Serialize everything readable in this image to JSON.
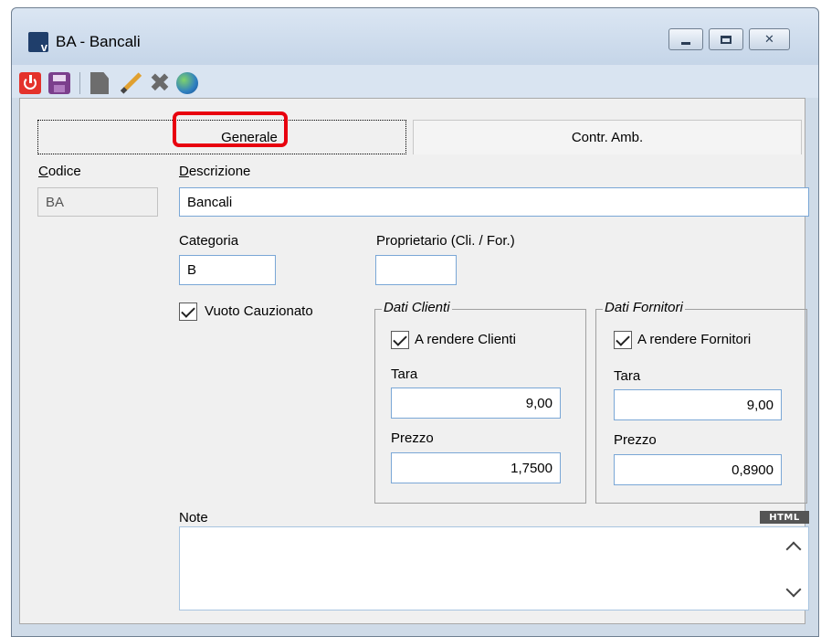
{
  "window": {
    "title": "BA - Bancali"
  },
  "tabs": [
    {
      "label": "Generale",
      "active": true
    },
    {
      "label": "Contr. Amb.",
      "active": false
    }
  ],
  "form": {
    "codice": {
      "label": "Codice",
      "value": "BA"
    },
    "descrizione": {
      "label": "Descrizione",
      "value": "Bancali"
    },
    "categoria": {
      "label": "Categoria",
      "value": "B"
    },
    "proprietario": {
      "label": "Proprietario (Cli. / For.)",
      "value": ""
    },
    "vuoto_cauzionato": {
      "label": "Vuoto Cauzionato",
      "checked": true
    },
    "dati_clienti": {
      "legend": "Dati Clienti",
      "a_rendere": {
        "label": "A rendere Clienti",
        "checked": true
      },
      "tara": {
        "label": "Tara",
        "value": "9,00"
      },
      "prezzo": {
        "label": "Prezzo",
        "value": "1,7500"
      }
    },
    "dati_fornitori": {
      "legend": "Dati Fornitori",
      "a_rendere": {
        "label": "A rendere Fornitori",
        "checked": true
      },
      "tara": {
        "label": "Tara",
        "value": "9,00"
      },
      "prezzo": {
        "label": "Prezzo",
        "value": "0,8900"
      }
    },
    "note": {
      "label": "Note",
      "value": "",
      "badge": "HTML"
    }
  },
  "toolbar_icons": [
    "power-icon",
    "save-icon",
    "new-document-icon",
    "edit-pencil-icon",
    "delete-icon",
    "globe-icon"
  ],
  "colors": {
    "highlight": "#e8000f",
    "titlebar": "#cfdbe8",
    "field_border": "#7aa7d6"
  }
}
